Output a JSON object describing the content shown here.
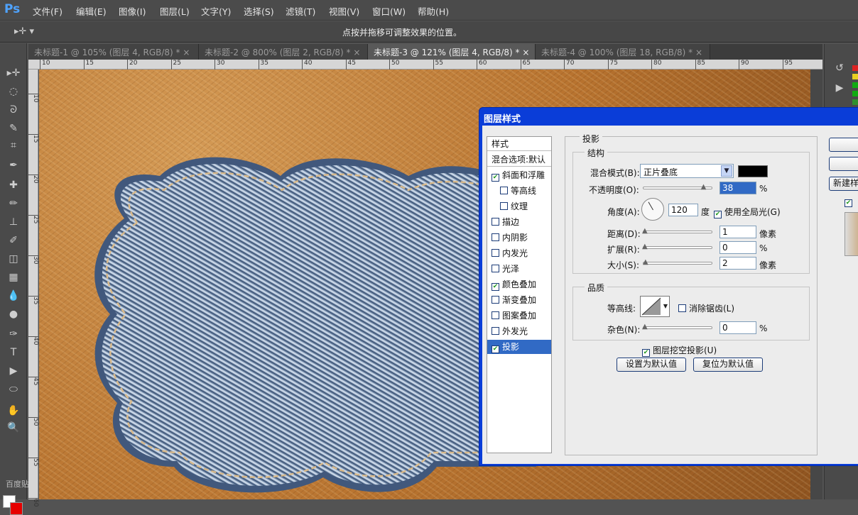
{
  "app": {
    "logo": "Ps"
  },
  "menu": [
    "文件(F)",
    "编辑(E)",
    "图像(I)",
    "图层(L)",
    "文字(Y)",
    "选择(S)",
    "滤镜(T)",
    "视图(V)",
    "窗口(W)",
    "帮助(H)"
  ],
  "options": {
    "tool_icon": "▸✛ ▾",
    "hint": "点按并拖移可调整效果的位置。"
  },
  "tabs": [
    {
      "label": "未标题-1 @ 105% (图层 4, RGB/8) *",
      "close": "×",
      "active": false
    },
    {
      "label": "未标题-2 @ 800% (图层 2, RGB/8) *",
      "close": "×",
      "active": false
    },
    {
      "label": "未标题-3 @ 121% (图层 4, RGB/8) *",
      "close": "×",
      "active": true
    },
    {
      "label": "未标题-4 @ 100% (图层 18, RGB/8) *",
      "close": "×",
      "active": false
    }
  ],
  "ruler": {
    "h": [
      "10",
      "15",
      "20",
      "25",
      "30",
      "35",
      "40",
      "45",
      "50",
      "55",
      "60",
      "65",
      "70",
      "75",
      "80",
      "85",
      "90",
      "95"
    ],
    "v": [
      "10",
      "15",
      "20",
      "25",
      "30",
      "35",
      "40",
      "45",
      "50",
      "55",
      "60"
    ]
  },
  "tools": [
    "move-icon",
    "marquee-icon",
    "lasso-icon",
    "quick-select-icon",
    "crop-icon",
    "eyedropper-icon",
    "heal-icon",
    "brush-icon",
    "stamp-icon",
    "history-brush-icon",
    "eraser-icon",
    "gradient-icon",
    "blur-icon",
    "dodge-icon",
    "pen-icon",
    "type-icon",
    "path-select-icon",
    "shape-icon",
    "hand-icon",
    "zoom-icon"
  ],
  "tool_glyphs": [
    "▸✛",
    "◌",
    "ᘐ",
    "✎",
    "⌗",
    "✒",
    "✚",
    "✏",
    "⊥",
    "✐",
    "◫",
    "▦",
    "💧",
    "●",
    "✑",
    "T",
    "▶",
    "⬭",
    "✋",
    "🔍"
  ],
  "colors": {
    "fg": "#ffffff",
    "bg": "#e60000",
    "accent": "#0a3dd8",
    "selection": "#316ac5"
  },
  "watermark": "百度贴吧 | photoshop吧",
  "dialog": {
    "title": "图层样式",
    "styles": [
      {
        "label": "样式",
        "check": null,
        "header": true
      },
      {
        "label": "混合选项:默认",
        "check": null,
        "header": true
      },
      {
        "label": "斜面和浮雕",
        "check": true
      },
      {
        "label": "等高线",
        "check": false,
        "indent": true
      },
      {
        "label": "纹理",
        "check": false,
        "indent": true
      },
      {
        "label": "描边",
        "check": false
      },
      {
        "label": "内阴影",
        "check": false
      },
      {
        "label": "内发光",
        "check": false
      },
      {
        "label": "光泽",
        "check": false
      },
      {
        "label": "颜色叠加",
        "check": true
      },
      {
        "label": "渐变叠加",
        "check": false
      },
      {
        "label": "图案叠加",
        "check": false
      },
      {
        "label": "外发光",
        "check": false
      },
      {
        "label": "投影",
        "check": true,
        "selected": true
      }
    ],
    "section": "投影",
    "structure": {
      "title": "结构",
      "blend_label": "混合模式(B):",
      "blend_value": "正片叠底",
      "blend_color": "#000000",
      "opacity_label": "不透明度(O):",
      "opacity_value": "38",
      "opacity_unit": "%",
      "opacity_level": 0.38,
      "angle_label": "角度(A):",
      "angle_value": "120",
      "angle_unit": "度",
      "global_light_label": "使用全局光(G)",
      "global_light": true,
      "distance_label": "距离(D):",
      "distance_value": "1",
      "distance_unit": "像素",
      "spread_label": "扩展(R):",
      "spread_value": "0",
      "spread_unit": "%",
      "size_label": "大小(S):",
      "size_value": "2",
      "size_unit": "像素"
    },
    "quality": {
      "title": "品质",
      "contour_label": "等高线:",
      "antialias_label": "消除锯齿(L)",
      "antialias": false,
      "noise_label": "杂色(N):",
      "noise_value": "0",
      "noise_unit": "%"
    },
    "knockout_label": "图层挖空投影(U)",
    "knockout": true,
    "set_default": "设置为默认值",
    "reset_default": "复位为默认值",
    "right_buttons": [
      "",
      "",
      "新建样"
    ],
    "preview_check": true
  }
}
